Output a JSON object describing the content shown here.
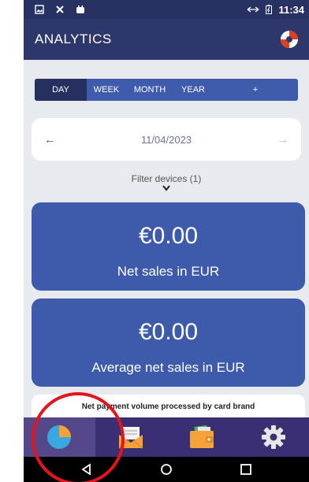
{
  "status_bar": {
    "time": "11:34",
    "icons": [
      "image-icon",
      "x-icon",
      "android-icon",
      "data-transfer-icon",
      "battery-icon"
    ]
  },
  "app_bar": {
    "title": "ANALYTICS",
    "help_icon": "lifebuoy-icon"
  },
  "tabs": [
    {
      "label": "DAY",
      "active": true
    },
    {
      "label": "WEEK",
      "active": false
    },
    {
      "label": "MONTH",
      "active": false
    },
    {
      "label": "YEAR",
      "active": false
    },
    {
      "label": "+",
      "active": false
    }
  ],
  "date_selector": {
    "prev_icon": "←",
    "date": "11/04/2023",
    "next_icon": "→"
  },
  "filter": {
    "label": "Filter devices (1)"
  },
  "stats": [
    {
      "value": "€0.00",
      "label": "Net sales in EUR"
    },
    {
      "value": "€0.00",
      "label": "Average net sales in EUR"
    }
  ],
  "brand_card": {
    "title": "Net payment volume processed by card brand"
  },
  "bottom_nav": [
    {
      "icon": "pie-chart-icon",
      "active": true
    },
    {
      "icon": "envelope-icon",
      "active": false
    },
    {
      "icon": "wallet-icon",
      "active": false
    },
    {
      "icon": "gear-icon",
      "active": false
    }
  ],
  "android_nav": [
    "back-icon",
    "home-icon",
    "recents-icon"
  ],
  "colors": {
    "primary": "#2e3769",
    "accent": "#3d5aab",
    "nav": "#3b2f73",
    "highlight": "#e4141b"
  }
}
